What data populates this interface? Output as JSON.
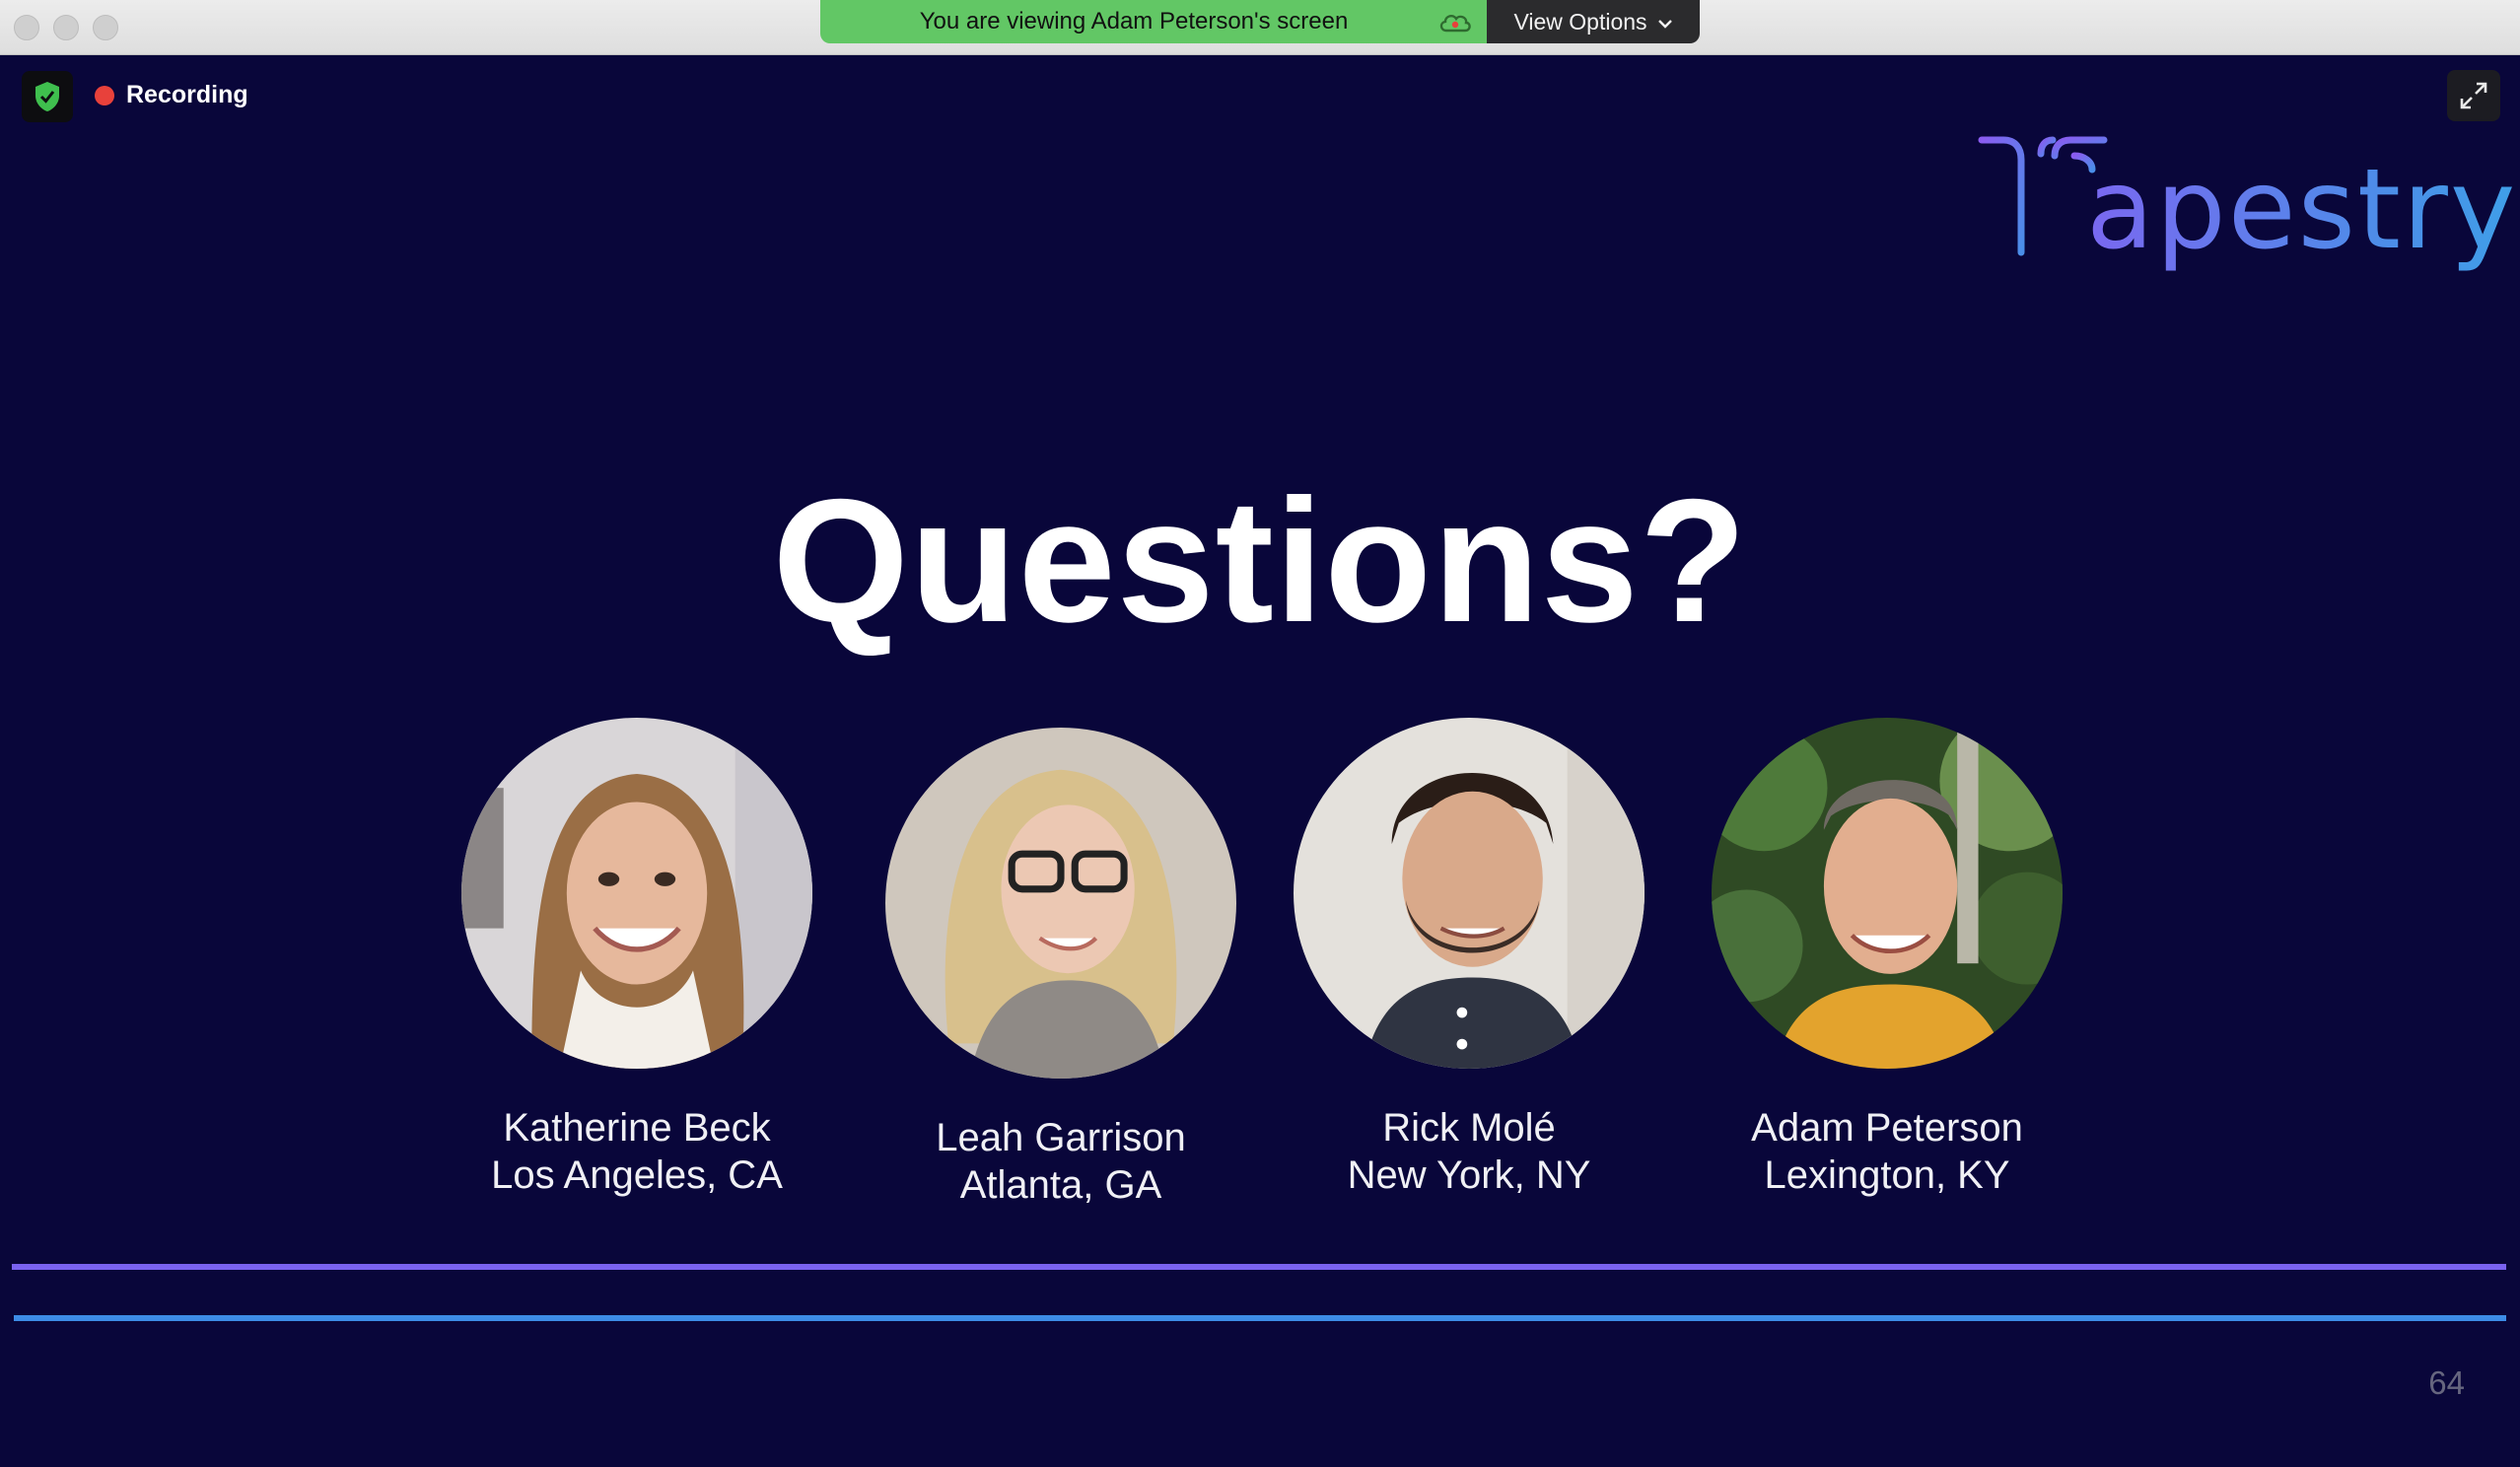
{
  "window": {
    "share_banner": "You are viewing Adam Peterson's screen",
    "view_options": "View Options"
  },
  "meeting": {
    "recording_label": "Recording"
  },
  "slide": {
    "logo_text": "apestry",
    "title": "Questions?",
    "page_number": "64",
    "people": [
      {
        "name": "Katherine Beck",
        "location": "Los Angeles, CA"
      },
      {
        "name": "Leah Garrison",
        "location": "Atlanta, GA"
      },
      {
        "name": "Rick Molé",
        "location": "New York, NY"
      },
      {
        "name": "Adam Peterson",
        "location": "Lexington, KY"
      }
    ]
  },
  "colors": {
    "screen_background": "#09063a",
    "banner_green": "#62c765",
    "recording_red": "#e8413b",
    "accent_purple": "#7a62f0",
    "accent_blue": "#3d8ce6"
  },
  "icons": [
    "shield-check-icon",
    "recording-dot-icon",
    "cloud-icon",
    "chevron-down-icon",
    "fullscreen-expand-icon"
  ]
}
